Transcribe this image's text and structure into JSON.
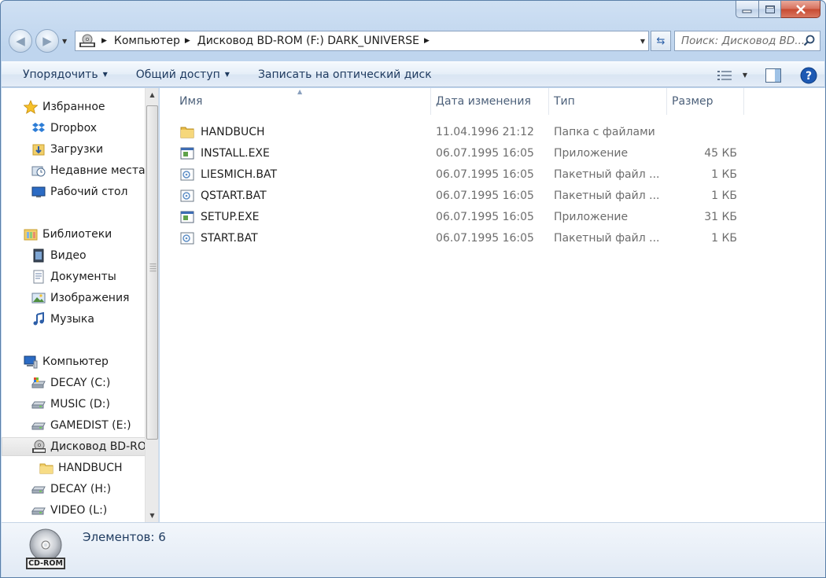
{
  "window": {
    "caption_buttons": [
      "minimize",
      "maximize",
      "close"
    ]
  },
  "address_bar": {
    "crumbs": [
      "Компьютер",
      "Дисковод BD-ROM (F:) DARK_UNIVERSE"
    ],
    "search_placeholder": "Поиск: Дисковод BD..."
  },
  "toolbar": {
    "organize": "Упорядочить",
    "share": "Общий доступ",
    "burn": "Записать на оптический диск"
  },
  "nav_pane": {
    "favorites": {
      "header": "Избранное",
      "items": [
        "Dropbox",
        "Загрузки",
        "Недавние места",
        "Рабочий стол"
      ]
    },
    "libraries": {
      "header": "Библиотеки",
      "items": [
        "Видео",
        "Документы",
        "Изображения",
        "Музыка"
      ]
    },
    "computer": {
      "header": "Компьютер",
      "drives": [
        "DECAY (C:)",
        "MUSIC (D:)",
        "GAMEDIST (E:)",
        "Дисковод BD-RO",
        "HANDBUCH",
        "DECAY (H:)",
        "VIDEO (L:)"
      ]
    }
  },
  "columns": {
    "name": "Имя",
    "date": "Дата изменения",
    "type": "Тип",
    "size": "Размер"
  },
  "files": [
    {
      "name": "HANDBUCH",
      "date": "11.04.1996 21:12",
      "type": "Папка с файлами",
      "size": "",
      "icon": "folder-icon"
    },
    {
      "name": "INSTALL.EXE",
      "date": "06.07.1995 16:05",
      "type": "Приложение",
      "size": "45 КБ",
      "icon": "exe-icon"
    },
    {
      "name": "LIESMICH.BAT",
      "date": "06.07.1995 16:05",
      "type": "Пакетный файл ...",
      "size": "1 КБ",
      "icon": "bat-icon"
    },
    {
      "name": "QSTART.BAT",
      "date": "06.07.1995 16:05",
      "type": "Пакетный файл ...",
      "size": "1 КБ",
      "icon": "bat-icon"
    },
    {
      "name": "SETUP.EXE",
      "date": "06.07.1995 16:05",
      "type": "Приложение",
      "size": "31 КБ",
      "icon": "exe-icon"
    },
    {
      "name": "START.BAT",
      "date": "06.07.1995 16:05",
      "type": "Пакетный файл ...",
      "size": "1 КБ",
      "icon": "bat-icon"
    }
  ],
  "status_bar": {
    "count": "Элементов: 6",
    "drive_label": "CD-ROM"
  }
}
